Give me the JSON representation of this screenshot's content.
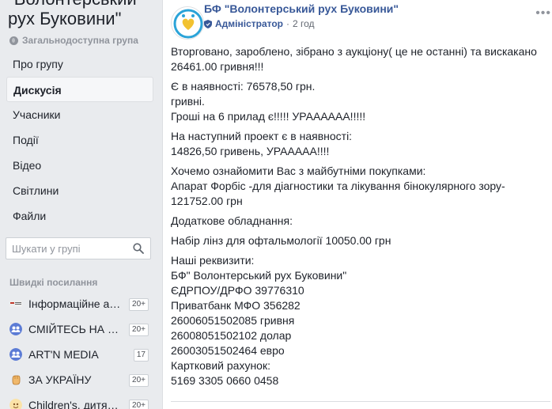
{
  "group": {
    "title": "\"Волонтерський рух Буковини\"",
    "type": "Загальнодоступна група"
  },
  "nav": {
    "items": [
      {
        "label": "Про групу",
        "active": false
      },
      {
        "label": "Дискусія",
        "active": true
      },
      {
        "label": "Учасники",
        "active": false
      },
      {
        "label": "Події",
        "active": false
      },
      {
        "label": "Відео",
        "active": false
      },
      {
        "label": "Світлини",
        "active": false
      },
      {
        "label": "Файли",
        "active": false
      }
    ]
  },
  "search": {
    "placeholder": "Шукати у групі"
  },
  "shortcuts": {
    "title": "Швидкі посилання",
    "items": [
      {
        "label": "Інформаційне аге...",
        "badge": "20+",
        "icon": "news-icon"
      },
      {
        "label": "СМІЙТЕСЬ НА ЗД...",
        "badge": "20+",
        "icon": "group-icon"
      },
      {
        "label": "ART'N MEDIA",
        "badge": "17",
        "icon": "group-icon"
      },
      {
        "label": "ЗА УКРАЇНУ",
        "badge": "20+",
        "icon": "fist-icon"
      },
      {
        "label": "Children's. дитячи...",
        "badge": "20+",
        "icon": "children-icon"
      }
    ]
  },
  "post": {
    "author": "БФ \"Волонтерський рух Буковини\"",
    "role": "Адміністратор",
    "time": "2 год",
    "paragraphs": [
      [
        "Вторговано, зароблено, зібрано з аукціону( це не останні) та вискакано",
        "26461.00 гривня!!!"
      ],
      [
        "Є в наявності: 76578,50 грн.",
        "гривні.",
        "Гроші на 6 прилад є!!!!! УРАААААА!!!!!"
      ],
      [
        "На наступний проект є в наявності:",
        "14826,50 гривень, УРААААА!!!!"
      ],
      [
        "Хочемо ознайомити Вас з майбутніми покупками:",
        "Апарат Форбіс -для діагностики та лікування бінокулярного зору-",
        "121752.00 грн"
      ],
      [
        "Додаткове обладнання:"
      ],
      [
        "Набір лінз для офтальмології 10050.00 грн"
      ],
      [
        "Наші реквизити:",
        "БФ\" Волонтерський рух Буковини\"",
        "ЄДРПОУ/ДРФО 39776310",
        "Приватбанк МФО 356282",
        "26006051502085 гривня",
        "26008051502102 долар",
        "26003051502464 евро",
        "Картковий рахунок:",
        "5169 3305 0660 0458"
      ]
    ]
  },
  "colors": {
    "link": "#385898",
    "muted": "#90949c",
    "background": "#e9ebee",
    "shortcut_group_icon": "#5b7bd5"
  }
}
